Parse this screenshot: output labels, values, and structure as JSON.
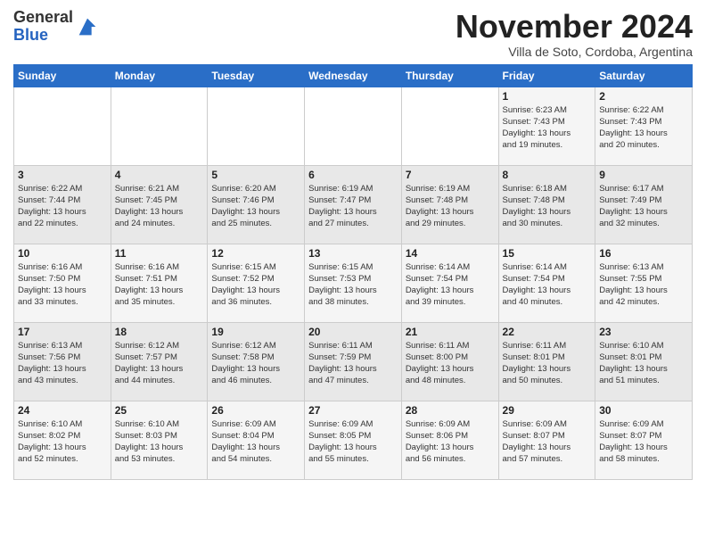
{
  "header": {
    "logo_general": "General",
    "logo_blue": "Blue",
    "month_title": "November 2024",
    "subtitle": "Villa de Soto, Cordoba, Argentina"
  },
  "weekdays": [
    "Sunday",
    "Monday",
    "Tuesday",
    "Wednesday",
    "Thursday",
    "Friday",
    "Saturday"
  ],
  "weeks": [
    [
      {
        "day": "",
        "info": ""
      },
      {
        "day": "",
        "info": ""
      },
      {
        "day": "",
        "info": ""
      },
      {
        "day": "",
        "info": ""
      },
      {
        "day": "",
        "info": ""
      },
      {
        "day": "1",
        "info": "Sunrise: 6:23 AM\nSunset: 7:43 PM\nDaylight: 13 hours\nand 19 minutes."
      },
      {
        "day": "2",
        "info": "Sunrise: 6:22 AM\nSunset: 7:43 PM\nDaylight: 13 hours\nand 20 minutes."
      }
    ],
    [
      {
        "day": "3",
        "info": "Sunrise: 6:22 AM\nSunset: 7:44 PM\nDaylight: 13 hours\nand 22 minutes."
      },
      {
        "day": "4",
        "info": "Sunrise: 6:21 AM\nSunset: 7:45 PM\nDaylight: 13 hours\nand 24 minutes."
      },
      {
        "day": "5",
        "info": "Sunrise: 6:20 AM\nSunset: 7:46 PM\nDaylight: 13 hours\nand 25 minutes."
      },
      {
        "day": "6",
        "info": "Sunrise: 6:19 AM\nSunset: 7:47 PM\nDaylight: 13 hours\nand 27 minutes."
      },
      {
        "day": "7",
        "info": "Sunrise: 6:19 AM\nSunset: 7:48 PM\nDaylight: 13 hours\nand 29 minutes."
      },
      {
        "day": "8",
        "info": "Sunrise: 6:18 AM\nSunset: 7:48 PM\nDaylight: 13 hours\nand 30 minutes."
      },
      {
        "day": "9",
        "info": "Sunrise: 6:17 AM\nSunset: 7:49 PM\nDaylight: 13 hours\nand 32 minutes."
      }
    ],
    [
      {
        "day": "10",
        "info": "Sunrise: 6:16 AM\nSunset: 7:50 PM\nDaylight: 13 hours\nand 33 minutes."
      },
      {
        "day": "11",
        "info": "Sunrise: 6:16 AM\nSunset: 7:51 PM\nDaylight: 13 hours\nand 35 minutes."
      },
      {
        "day": "12",
        "info": "Sunrise: 6:15 AM\nSunset: 7:52 PM\nDaylight: 13 hours\nand 36 minutes."
      },
      {
        "day": "13",
        "info": "Sunrise: 6:15 AM\nSunset: 7:53 PM\nDaylight: 13 hours\nand 38 minutes."
      },
      {
        "day": "14",
        "info": "Sunrise: 6:14 AM\nSunset: 7:54 PM\nDaylight: 13 hours\nand 39 minutes."
      },
      {
        "day": "15",
        "info": "Sunrise: 6:14 AM\nSunset: 7:54 PM\nDaylight: 13 hours\nand 40 minutes."
      },
      {
        "day": "16",
        "info": "Sunrise: 6:13 AM\nSunset: 7:55 PM\nDaylight: 13 hours\nand 42 minutes."
      }
    ],
    [
      {
        "day": "17",
        "info": "Sunrise: 6:13 AM\nSunset: 7:56 PM\nDaylight: 13 hours\nand 43 minutes."
      },
      {
        "day": "18",
        "info": "Sunrise: 6:12 AM\nSunset: 7:57 PM\nDaylight: 13 hours\nand 44 minutes."
      },
      {
        "day": "19",
        "info": "Sunrise: 6:12 AM\nSunset: 7:58 PM\nDaylight: 13 hours\nand 46 minutes."
      },
      {
        "day": "20",
        "info": "Sunrise: 6:11 AM\nSunset: 7:59 PM\nDaylight: 13 hours\nand 47 minutes."
      },
      {
        "day": "21",
        "info": "Sunrise: 6:11 AM\nSunset: 8:00 PM\nDaylight: 13 hours\nand 48 minutes."
      },
      {
        "day": "22",
        "info": "Sunrise: 6:11 AM\nSunset: 8:01 PM\nDaylight: 13 hours\nand 50 minutes."
      },
      {
        "day": "23",
        "info": "Sunrise: 6:10 AM\nSunset: 8:01 PM\nDaylight: 13 hours\nand 51 minutes."
      }
    ],
    [
      {
        "day": "24",
        "info": "Sunrise: 6:10 AM\nSunset: 8:02 PM\nDaylight: 13 hours\nand 52 minutes."
      },
      {
        "day": "25",
        "info": "Sunrise: 6:10 AM\nSunset: 8:03 PM\nDaylight: 13 hours\nand 53 minutes."
      },
      {
        "day": "26",
        "info": "Sunrise: 6:09 AM\nSunset: 8:04 PM\nDaylight: 13 hours\nand 54 minutes."
      },
      {
        "day": "27",
        "info": "Sunrise: 6:09 AM\nSunset: 8:05 PM\nDaylight: 13 hours\nand 55 minutes."
      },
      {
        "day": "28",
        "info": "Sunrise: 6:09 AM\nSunset: 8:06 PM\nDaylight: 13 hours\nand 56 minutes."
      },
      {
        "day": "29",
        "info": "Sunrise: 6:09 AM\nSunset: 8:07 PM\nDaylight: 13 hours\nand 57 minutes."
      },
      {
        "day": "30",
        "info": "Sunrise: 6:09 AM\nSunset: 8:07 PM\nDaylight: 13 hours\nand 58 minutes."
      }
    ]
  ]
}
